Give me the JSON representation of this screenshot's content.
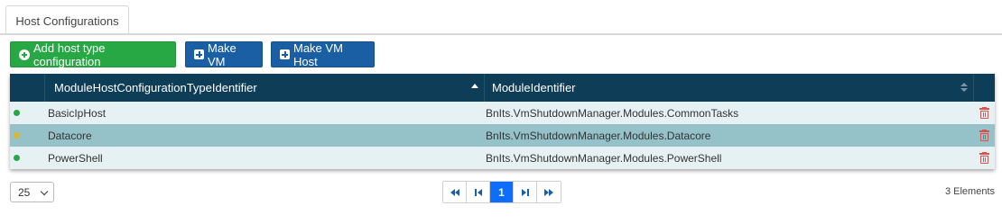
{
  "tabs": [
    {
      "label": "Host Configurations",
      "active": true
    }
  ],
  "toolbar": {
    "add_label": "Add host type configuration",
    "make_vm_label": "Make VM",
    "make_vm_host_label": "Make VM Host"
  },
  "table": {
    "columns": [
      {
        "label": "ModuleHostConfigurationTypeIdentifier",
        "sort": "asc"
      },
      {
        "label": "ModuleIdentifier",
        "sort": "none"
      }
    ],
    "rows": [
      {
        "type": "BasicIpHost",
        "module": "BnIts.VmShutdownManager.Modules.CommonTasks",
        "status": "green",
        "selected": false
      },
      {
        "type": "Datacore",
        "module": "BnIts.VmShutdownManager.Modules.Datacore",
        "status": "yellow",
        "selected": true
      },
      {
        "type": "PowerShell",
        "module": "BnIts.VmShutdownManager.Modules.PowerShell",
        "status": "green",
        "selected": false
      }
    ]
  },
  "pagination": {
    "page_size": "25",
    "current_page": "1",
    "count_text": "3 Elements"
  },
  "colors": {
    "header_bg": "#0e3d57",
    "selected_row": "#95c1c8",
    "row_bg": "#e6f1f4",
    "status_green": "#28a745",
    "status_yellow": "#e0b52a",
    "delete": "#d9534f",
    "primary": "#1a5fa3",
    "success": "#28a745"
  }
}
